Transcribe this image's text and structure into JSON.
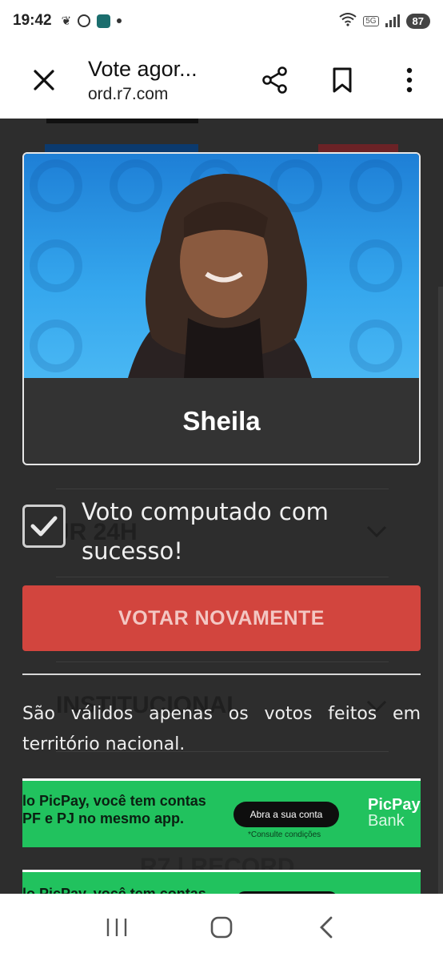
{
  "status_bar": {
    "time": "19:42",
    "network_badge": "5G",
    "battery": "87"
  },
  "toolbar": {
    "title": "Vote agor...",
    "url": "ord.r7.com"
  },
  "card": {
    "name": "Sheila"
  },
  "background_sections": {
    "section_1": "JR 24H",
    "section_2": "INSTITUCIONAL",
    "section_3": "R7 | RECORD"
  },
  "vote": {
    "success_message": "Voto computado com sucesso!",
    "revote_button": "VOTAR NOVAMENTE",
    "note": "São válidos apenas os votos feitos em território nacional."
  },
  "ad": {
    "headline": "lo PicPay, você tem contas PF e PJ no mesmo app.",
    "headline_2": "lo PicPay, você tem contas",
    "cta": "Abra a sua conta",
    "fine_print": "*Consulte condições",
    "brand": "PicPay",
    "brand_sub": "Bank"
  },
  "colors": {
    "accent_red": "#d2453e",
    "page_bg": "#2d2d2d",
    "ad_green": "#21c25e"
  }
}
